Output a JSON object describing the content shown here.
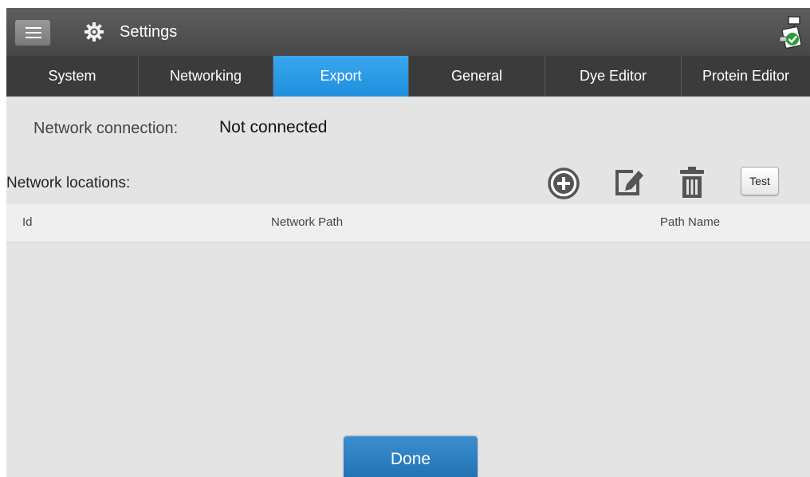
{
  "header": {
    "title": "Settings",
    "menu_icon": "hamburger-menu-icon",
    "settings_icon": "gear-icon",
    "status_icon": "network-connected-icon"
  },
  "tabs": [
    {
      "label": "System",
      "active": false
    },
    {
      "label": "Networking",
      "active": false
    },
    {
      "label": "Export",
      "active": true
    },
    {
      "label": "General",
      "active": false
    },
    {
      "label": "Dye Editor",
      "active": false
    },
    {
      "label": "Protein Editor",
      "active": false
    }
  ],
  "connection": {
    "label": "Network connection:",
    "value": "Not connected"
  },
  "locations": {
    "label": "Network locations:",
    "toolbar": {
      "add_icon": "add-circle-icon",
      "edit_icon": "edit-icon",
      "delete_icon": "trash-icon",
      "test_label": "Test"
    },
    "columns": [
      "Id",
      "Network Path",
      "Path Name"
    ],
    "rows": []
  },
  "footer": {
    "done_label": "Done"
  },
  "colors": {
    "active_tab": "#2196e6",
    "tab_bar": "#3b3b3b",
    "title_bar": "#4f4f4f",
    "done_button": "#2a7dc0",
    "background": "#e4e4e4"
  }
}
